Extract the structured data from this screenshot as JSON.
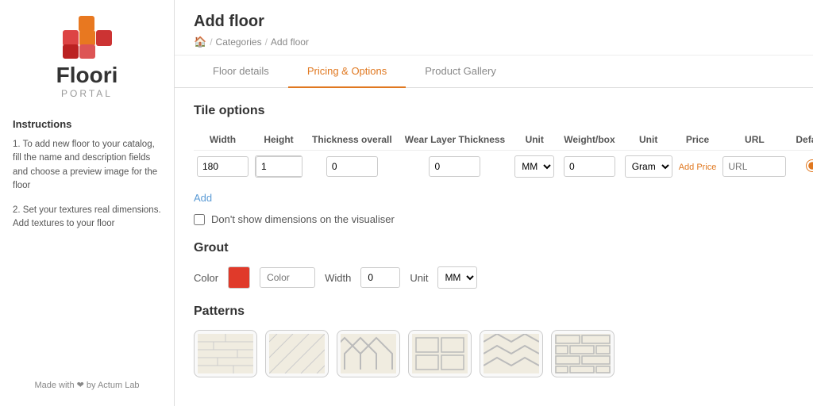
{
  "sidebar": {
    "logo_name": "Floori",
    "logo_portal": "PORTAL",
    "instructions_title": "Instructions",
    "instruction_1": "1. To add new floor to your catalog, fill the name and description fields and choose a preview image for the floor",
    "instruction_2": "2. Set your textures real dimensions. Add textures to your floor",
    "footer": "Made with ❤ by Actum Lab"
  },
  "page": {
    "title": "Add floor",
    "breadcrumb_home": "🏠",
    "breadcrumb_sep1": "/",
    "breadcrumb_categories": "Categories",
    "breadcrumb_sep2": "/",
    "breadcrumb_current": "Add floor"
  },
  "tabs": [
    {
      "label": "Floor details",
      "active": false
    },
    {
      "label": "Pricing & Options",
      "active": true
    },
    {
      "label": "Product Gallery",
      "active": false
    }
  ],
  "tile_options": {
    "title": "Tile options",
    "columns": [
      "Width",
      "Height",
      "Thickness overall",
      "Wear Layer Thickness",
      "Unit",
      "Weight/box",
      "Unit",
      "Price",
      "URL",
      "Default"
    ],
    "row": {
      "width": "180",
      "height": "1",
      "thickness": "0",
      "wear_layer": "0",
      "unit": "MM",
      "weight": "0",
      "weight_unit": "Gram",
      "add_price_label": "Add Price",
      "url_placeholder": "URL"
    },
    "add_label": "Add",
    "checkbox_label": "Don't show dimensions on the visualiser"
  },
  "grout": {
    "title": "Grout",
    "color_label": "Color",
    "color_placeholder": "Color",
    "width_label": "Width",
    "width_value": "0",
    "unit_label": "Unit",
    "unit_value": "MM"
  },
  "patterns": {
    "title": "Patterns"
  }
}
